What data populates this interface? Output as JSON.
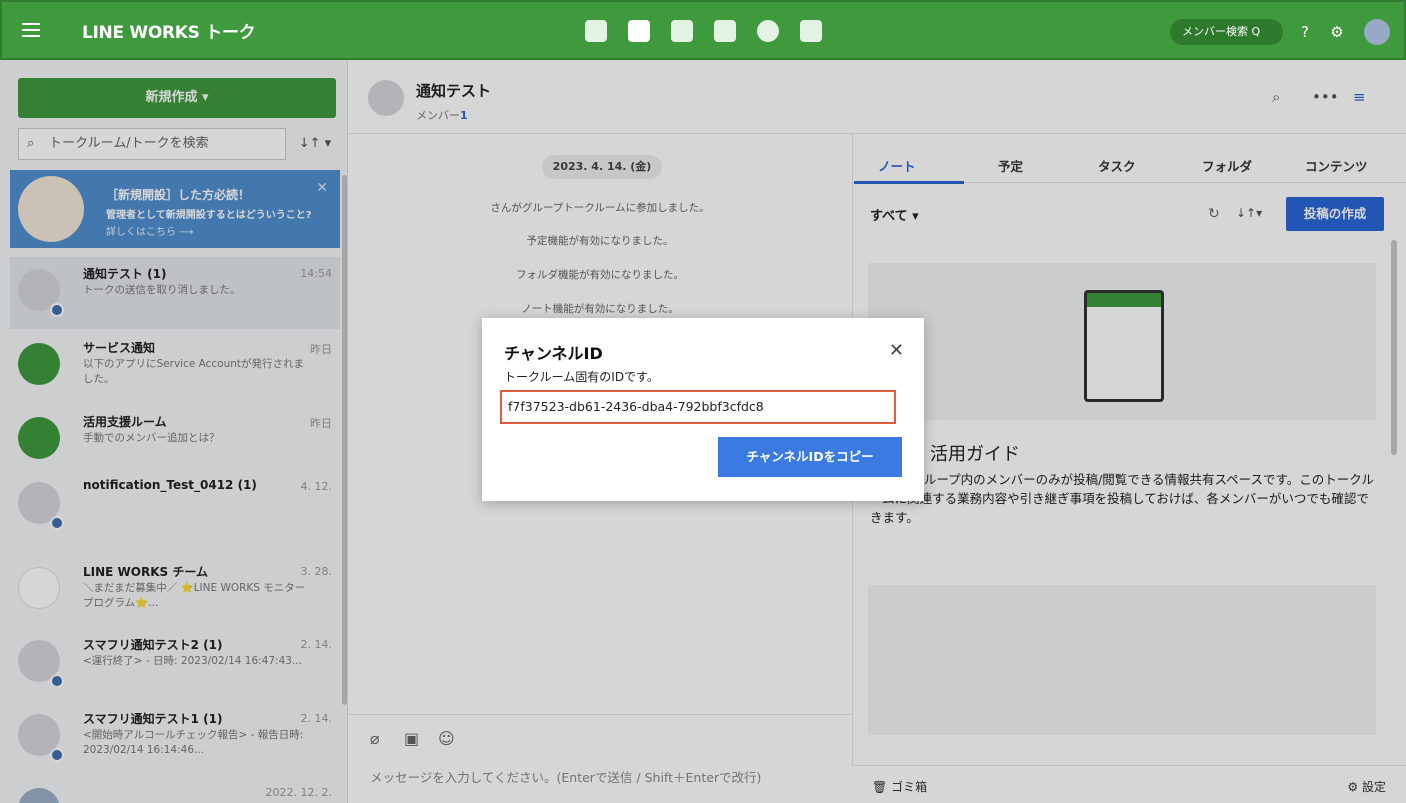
{
  "header": {
    "brand": "LINE WORKS トーク",
    "member_search": "メンバー検索 Q",
    "help_icon": "?",
    "settings_icon": "⚙"
  },
  "sidebar": {
    "new_button": "新規作成 ▾",
    "search_placeholder": "トークルーム/トークを検索",
    "sort_label": "↓↑ ▾",
    "banner": {
      "title": "［新規開設］した方必読！",
      "subtitle": "管理者として新規開設するとはどういうこと?",
      "link": "詳しくはこちら ⟶",
      "close": "✕"
    },
    "rooms": [
      {
        "name": "通知テスト (1)",
        "time": "14:54",
        "preview": "トークの送信を取り消しました。"
      },
      {
        "name": "サービス通知",
        "time": "昨日",
        "preview": "以下のアプリにService Accountが発行されました。"
      },
      {
        "name": "活用支援ルーム",
        "time": "昨日",
        "preview": "手動でのメンバー追加とは？"
      },
      {
        "name": "notification_Test_0412 (1)",
        "time": "4. 12.",
        "preview": ""
      },
      {
        "name": "LINE WORKS チーム",
        "time": "3. 28.",
        "preview": "＼まだまだ募集中／ ⭐LINE WORKS モニタープログラム⭐..."
      },
      {
        "name": "スマフリ通知テスト2 (1)",
        "time": "2. 14.",
        "preview": "<運行終了> - 日時: 2023/02/14 16:47:43..."
      },
      {
        "name": "スマフリ通知テスト1 (1)",
        "time": "2. 14.",
        "preview": "<開始時アルコールチェック報告> - 報告日時: 2023/02/14 16:14:46..."
      },
      {
        "name": "",
        "time": "2022. 12. 2.",
        "preview": ""
      }
    ]
  },
  "chat": {
    "title": "通知テスト",
    "members_label": "メンバー",
    "members_count": "1",
    "date": "2023. 4. 14. (金)",
    "system_messages": [
      "さんがグループトークルームに参加しました。",
      "予定機能が有効になりました。",
      "フォルダ機能が有効になりました。",
      "ノート機能が有効になりました。"
    ],
    "input_placeholder": "メッセージを入力してください。(Enterで送信 / Shift＋Enterで改行)"
  },
  "right_panel": {
    "tabs": [
      "ノート",
      "予定",
      "タスク",
      "フォルダ",
      "コンテンツ"
    ],
    "filter": "すべて ▾",
    "post_button": "投稿の作成",
    "guide_title": "活用ガイド",
    "guide_text": "チーム/グループ内のメンバーのみが投稿/閲覧できる情報共有スペースです。このトークルームに関連する業務内容や引き継ぎ事項を投稿しておけば、各メンバーがいつでも確認できます。",
    "trash": "ゴミ箱",
    "settings": "設定"
  },
  "modal": {
    "title": "チャンネルID",
    "subtitle": "トークルーム固有のIDです。",
    "channel_id": "f7f37523-db61-2436-dba4-792bbf3cfdc8",
    "copy_button": "チャンネルIDをコピー",
    "close": "✕"
  },
  "colors": {
    "brand_green": "#3e9a3d",
    "accent_blue": "#2a66d8",
    "highlight_red": "#e05a42"
  }
}
